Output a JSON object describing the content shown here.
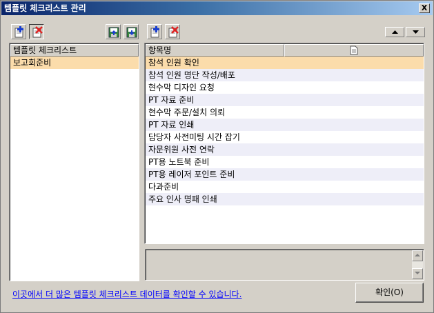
{
  "window": {
    "title": "템플릿 체크리스트 관리",
    "close_label": "X"
  },
  "left_panel": {
    "header": "템플릿 체크리스트",
    "items": [
      "보고회준비"
    ],
    "selected_index": 0
  },
  "right_panel": {
    "header": "항목명",
    "header_icon": "document-icon",
    "items": [
      "참석 인원 확인",
      "참석 인원 명단 작성/배포",
      "현수막 디자인 요청",
      "PT 자료 준비",
      "현수막 주문/설치 의뢰",
      "PT 자료 인쇄",
      "담당자 사전미팅 시간 잡기",
      "자문위원 사전 연락",
      "PT용 노트북 준비",
      "PT용 레이저 포인트 준비",
      "다과준비",
      "주요 인사 명패 인쇄"
    ],
    "selected_index": 0
  },
  "toolbar": {
    "left_icons": [
      "add-icon",
      "delete-icon"
    ],
    "mid_icons": [
      "import-icon",
      "save-icon"
    ],
    "right_icons": [
      "add-item-icon",
      "delete-item-icon"
    ],
    "move_icons": [
      "move-up-icon",
      "move-down-icon"
    ]
  },
  "footer": {
    "link_text": "이곳에서 더 많은 템플릿 체크리스트 데이터를 확인할 수 있습니다.",
    "ok_label": "확인(O)"
  },
  "colors": {
    "selected_row": "#fbdcab",
    "alt_row": "#eeeef8",
    "title_start": "#0a246a",
    "title_end": "#a6caf0",
    "link": "#0000ff"
  }
}
